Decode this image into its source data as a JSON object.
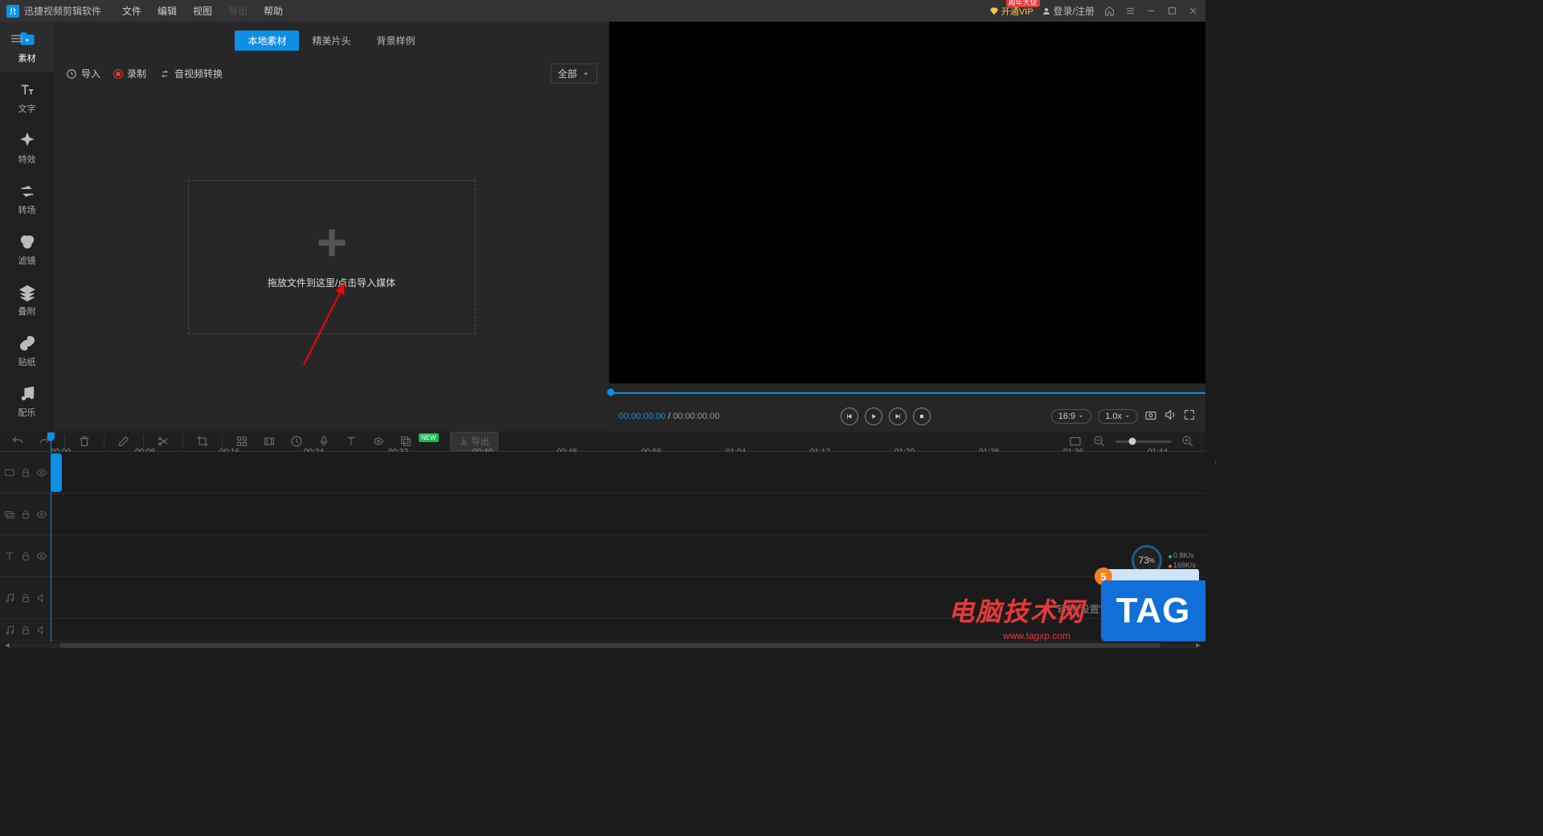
{
  "titlebar": {
    "app_name": "迅捷视频剪辑软件",
    "menu": {
      "file": "文件",
      "edit": "编辑",
      "view": "视图",
      "export": "导出",
      "help": "帮助"
    },
    "vip_label": "开通VIP",
    "vip_promo": "周年大促",
    "login_label": "登录/注册"
  },
  "sidebar": {
    "items": [
      {
        "label": "素材"
      },
      {
        "label": "文字"
      },
      {
        "label": "特效"
      },
      {
        "label": "转场"
      },
      {
        "label": "滤镜"
      },
      {
        "label": "叠附"
      },
      {
        "label": "贴纸"
      },
      {
        "label": "配乐"
      }
    ]
  },
  "media": {
    "tabs": {
      "local": "本地素材",
      "templates": "精美片头",
      "backgrounds": "背景样例"
    },
    "import_label": "导入",
    "record_label": "录制",
    "convert_label": "音视频转换",
    "filter_label": "全部",
    "dropzone_text": "拖放文件到这里/点击导入媒体"
  },
  "preview": {
    "current_time": "00:00:00.00",
    "time_sep": " / ",
    "total_time": "00:00:00.00",
    "aspect": "16:9",
    "speed": "1.0x"
  },
  "timeline": {
    "export_label": "导出",
    "new_badge": "NEW",
    "marks": [
      "00:00",
      "00:08",
      "00:16",
      "00:24",
      "00:32",
      "00:40",
      "00:48",
      "00:56",
      "01:04",
      "01:12",
      "01:20",
      "01:28",
      "01:36",
      "01:44"
    ]
  },
  "overlays": {
    "watermark_main": "电脑技术网",
    "watermark_url": "www.tagxp.com",
    "watermark_tag": "TAG",
    "windows_hint": "转到\"设置\"以激活 Windows",
    "netmon_pct": "73",
    "netmon_pct_unit": "%",
    "netmon_up": "0.8K/s",
    "netmon_down": "168K/s"
  }
}
